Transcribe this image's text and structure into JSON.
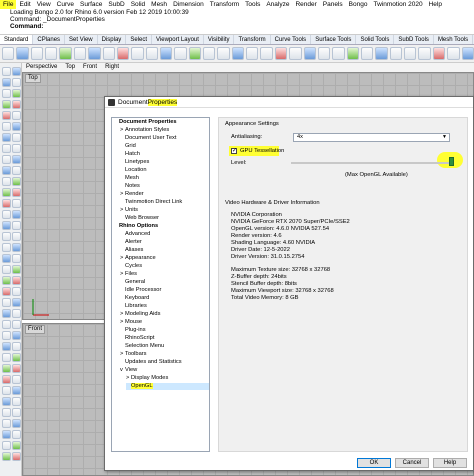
{
  "menubar": {
    "items": [
      "File",
      "Edit",
      "View",
      "Curve",
      "Surface",
      "SubD",
      "Solid",
      "Mesh",
      "Dimension",
      "Transform",
      "Tools",
      "Analyze",
      "Render",
      "Panels",
      "Bongo",
      "Twinmotion 2020",
      "Help"
    ]
  },
  "command": {
    "lines": [
      "Loading Bongo 2.0 for Rhino 6.0 version Feb 12 2019 10:00:39",
      "Command: _DocumentProperties"
    ],
    "prompt": "Command:"
  },
  "tabs": {
    "items": [
      "Standard",
      "CPlanes",
      "Set View",
      "Display",
      "Select",
      "Viewport Layout",
      "Visibility",
      "Transform",
      "Curve Tools",
      "Surface Tools",
      "Solid Tools",
      "SubD Tools",
      "Mesh Tools",
      "Re"
    ]
  },
  "viewports": {
    "tabs": [
      "Perspective",
      "Top",
      "Front",
      "Right"
    ],
    "top_label": "Top",
    "front_label": "Front"
  },
  "dialog": {
    "title_a": "Document ",
    "title_b": "Properties",
    "tree": [
      {
        "label": "Document Properties",
        "level": 0,
        "bold": true,
        "toggle": ""
      },
      {
        "label": "Annotation Styles",
        "level": 1,
        "toggle": ">"
      },
      {
        "label": "Document User Text",
        "level": 1,
        "toggle": ""
      },
      {
        "label": "Grid",
        "level": 1,
        "toggle": ""
      },
      {
        "label": "Hatch",
        "level": 1,
        "toggle": ""
      },
      {
        "label": "Linetypes",
        "level": 1,
        "toggle": ""
      },
      {
        "label": "Location",
        "level": 1,
        "toggle": ""
      },
      {
        "label": "Mesh",
        "level": 1,
        "toggle": ""
      },
      {
        "label": "Notes",
        "level": 1,
        "toggle": ""
      },
      {
        "label": "Render",
        "level": 1,
        "toggle": ">"
      },
      {
        "label": "Twinmotion Direct Link",
        "level": 1,
        "toggle": ""
      },
      {
        "label": "Units",
        "level": 1,
        "toggle": ">"
      },
      {
        "label": "Web Browser",
        "level": 1,
        "toggle": ""
      },
      {
        "label": "Rhino Options",
        "level": 0,
        "bold": true,
        "toggle": ""
      },
      {
        "label": "Advanced",
        "level": 1,
        "toggle": ""
      },
      {
        "label": "Alerter",
        "level": 1,
        "toggle": ""
      },
      {
        "label": "Aliases",
        "level": 1,
        "toggle": ""
      },
      {
        "label": "Appearance",
        "level": 1,
        "toggle": ">"
      },
      {
        "label": "Cycles",
        "level": 1,
        "toggle": ""
      },
      {
        "label": "Files",
        "level": 1,
        "toggle": ">"
      },
      {
        "label": "General",
        "level": 1,
        "toggle": ""
      },
      {
        "label": "Idle Processor",
        "level": 1,
        "toggle": ""
      },
      {
        "label": "Keyboard",
        "level": 1,
        "toggle": ""
      },
      {
        "label": "Libraries",
        "level": 1,
        "toggle": ""
      },
      {
        "label": "Modeling Aids",
        "level": 1,
        "toggle": ">"
      },
      {
        "label": "Mouse",
        "level": 1,
        "toggle": ">"
      },
      {
        "label": "Plug-ins",
        "level": 1,
        "toggle": ""
      },
      {
        "label": "RhinoScript",
        "level": 1,
        "toggle": ""
      },
      {
        "label": "Selection Menu",
        "level": 1,
        "toggle": ""
      },
      {
        "label": "Toolbars",
        "level": 1,
        "toggle": ">"
      },
      {
        "label": "Updates and Statistics",
        "level": 1,
        "toggle": ""
      },
      {
        "label": "View",
        "level": 1,
        "toggle": "v"
      },
      {
        "label": "Display Modes",
        "level": 2,
        "toggle": ">"
      },
      {
        "label": "OpenGL",
        "level": 2,
        "toggle": "",
        "selected": true
      }
    ],
    "appearance": {
      "heading": "Appearance Settings",
      "antialiasing_label": "Antialiasing:",
      "antialiasing_value": "4x",
      "gpu_label": "GPU Tessellation",
      "gpu_checked": true,
      "level_label": "Level:",
      "level_value": 1.0,
      "level_caption": "(Max OpenGL Available)"
    },
    "video": {
      "heading": "Video Hardware & Driver Information",
      "info_block1": [
        "NVIDIA Corporation",
        "NVIDIA GeForce RTX 2070 Super/PCIe/SSE2",
        "OpenGL version: 4.6.0 NVIDIA 527.54",
        "Render version: 4.6",
        "Shading Language: 4.60 NVIDIA",
        "Driver Date: 12-5-2022",
        "Driver Version: 31.0.15.2754"
      ],
      "info_block2": [
        "Maximum Texture size: 32768 x 32768",
        "Z-Buffer depth: 24bits",
        "Stencil Buffer depth: 8bits",
        "Maximum Viewport size: 32768 x 32768",
        "Total Video Memory: 8 GB"
      ]
    },
    "buttons": {
      "ok": "OK",
      "cancel": "Cancel",
      "help": "Help"
    }
  },
  "colors": {
    "highlight": "#ffff33",
    "slider_thumb": "#2f8f3e",
    "selection": "#cde8ff"
  }
}
